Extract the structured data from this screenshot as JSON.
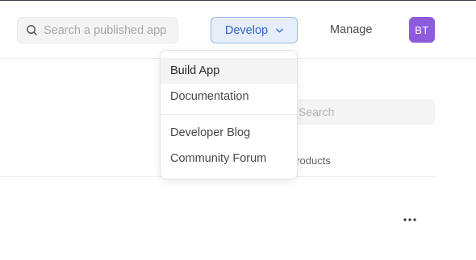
{
  "header": {
    "search": {
      "placeholder": "Search a published app",
      "icon": "search-icon"
    },
    "develop_label": "Develop",
    "manage_label": "Manage",
    "avatar_initials": "BT",
    "colors": {
      "accent": "#2f63cf",
      "accent_bg": "#e6edfb",
      "avatar_bg": "#8e5bdd"
    }
  },
  "dropdown": {
    "items_primary": [
      {
        "label": "Build App"
      },
      {
        "label": "Documentation"
      }
    ],
    "items_secondary": [
      {
        "label": "Developer Blog"
      },
      {
        "label": "Community Forum"
      }
    ]
  },
  "content": {
    "search_placeholder": "Search",
    "tab_label": "products",
    "more_icon": "more-horizontal-icon"
  }
}
